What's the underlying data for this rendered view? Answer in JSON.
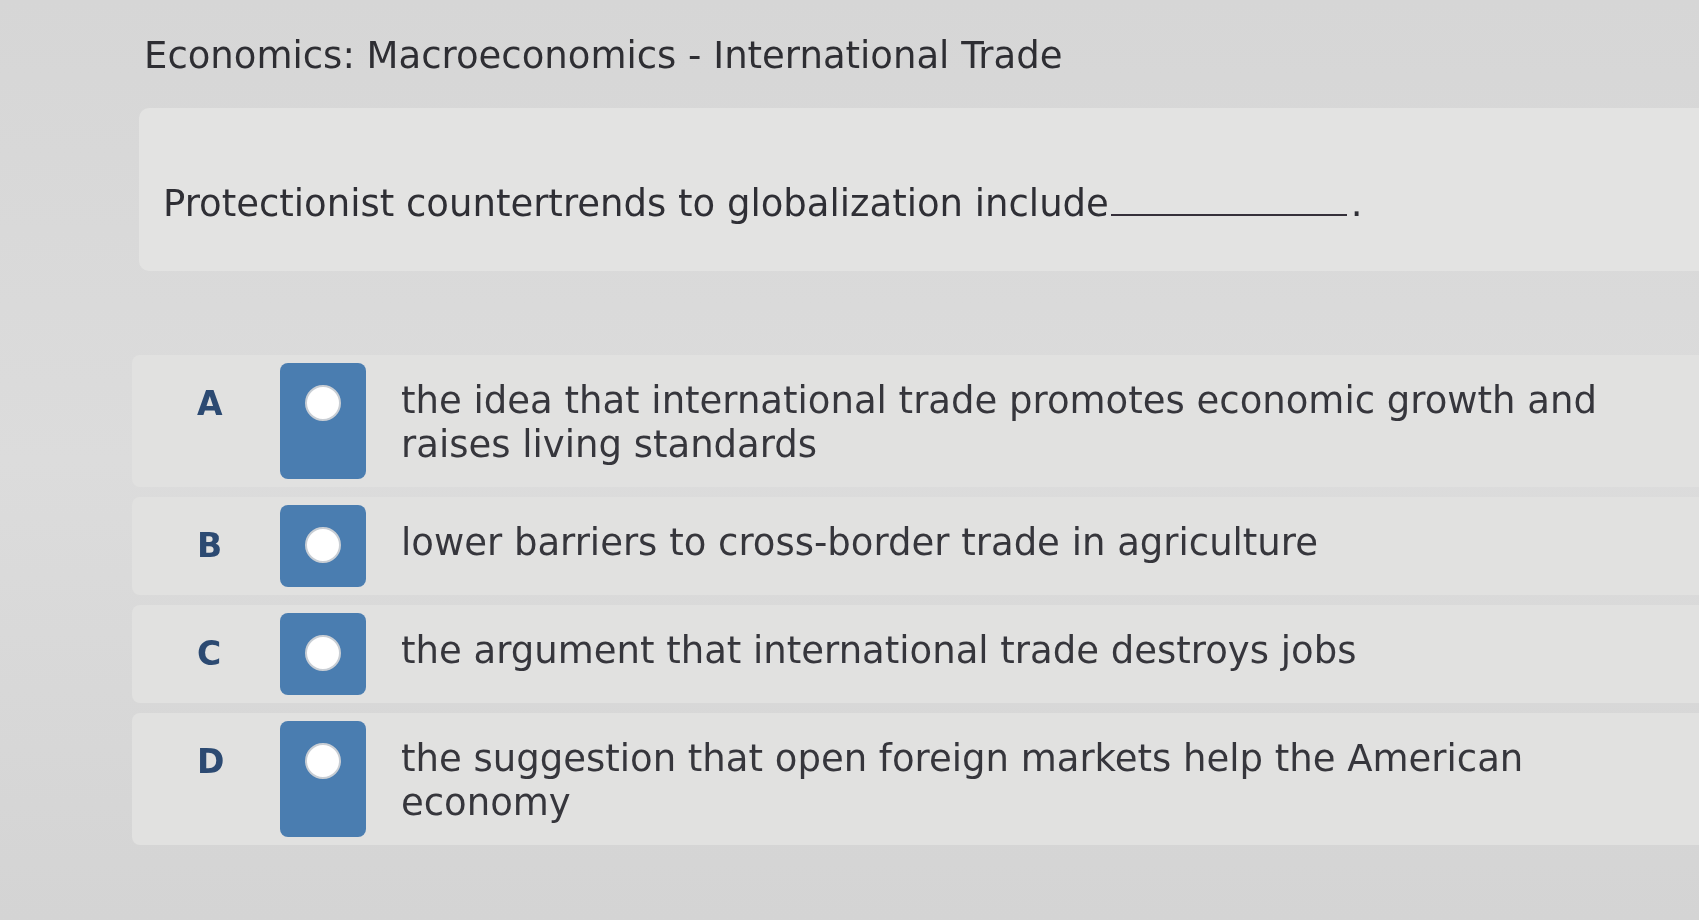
{
  "title": "Economics: Macroeconomics - International Trade",
  "question": {
    "prompt": "Protectionist countertrends to globalization include",
    "prompt_end": "."
  },
  "options": [
    {
      "letter": "A",
      "text": "the idea that international trade promotes economic growth and raises living standards",
      "selected": false
    },
    {
      "letter": "B",
      "text": "lower barriers to cross-border trade in agriculture",
      "selected": false
    },
    {
      "letter": "C",
      "text": "the argument that international trade destroys jobs",
      "selected": false
    },
    {
      "letter": "D",
      "text": "the suggestion that open foreign markets help the American economy",
      "selected": false
    }
  ]
}
